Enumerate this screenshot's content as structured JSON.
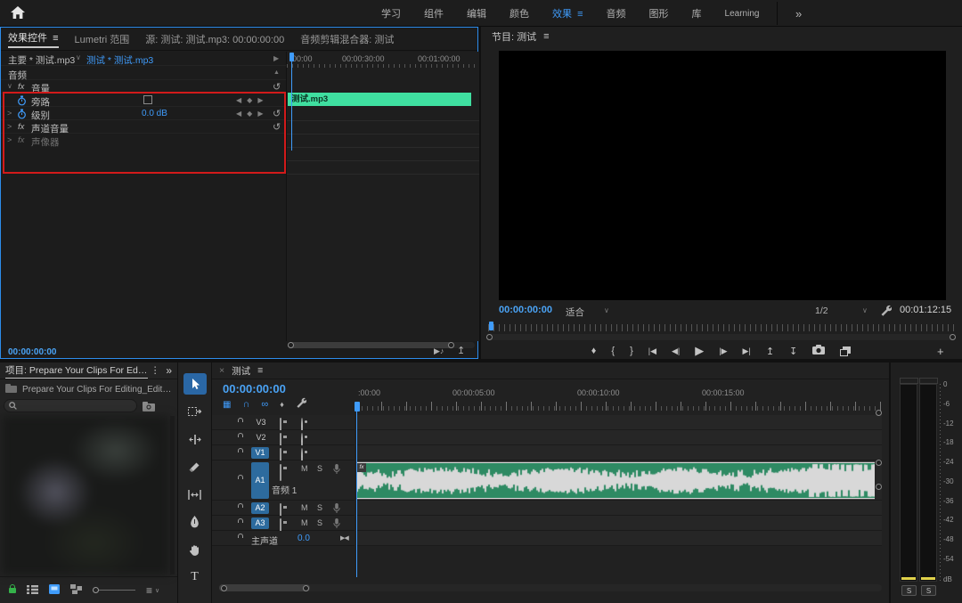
{
  "app": {
    "workspaces": [
      "学习",
      "组件",
      "编辑",
      "颜色",
      "效果",
      "音频",
      "图形",
      "库",
      "Learning"
    ],
    "active_workspace": "效果",
    "overflow": "»"
  },
  "icons": {
    "menu": "≡",
    "kebab": "⋮",
    "overflow": "»",
    "close": "×",
    "chev_down": "∨",
    "chev_right": "▶",
    "chev_up": "▲",
    "twirl_closed": ">",
    "reset": "↺",
    "kf_prev": "◀",
    "kf_diamond": "◆",
    "kf_next": "▶",
    "fx": "fx",
    "magnet": "∩",
    "nest": "▦",
    "link": "∞",
    "marker": "♦",
    "bowtie": "▶◀",
    "play_audio": "▶♪",
    "export_frame": "↥",
    "sort": "≡",
    "plus": "+"
  },
  "effect_controls": {
    "tabs": [
      {
        "label": "效果控件",
        "active": true
      },
      {
        "label": "Lumetri 范围",
        "active": false
      },
      {
        "label": "源: 测试: 测试.mp3: 00:00:00:00",
        "active": false
      },
      {
        "label": "音频剪辑混合器: 测试",
        "active": false
      }
    ],
    "clip_selector": {
      "master": "主要 * 测试.mp3",
      "linked": "测试 * 测试.mp3"
    },
    "rows": {
      "section": "音频",
      "volume": "音量",
      "bypass": "旁路",
      "level": "级别",
      "level_value": "0.0 dB",
      "channel_volume": "声道音量",
      "panner": "声像器"
    },
    "mini_ruler": [
      "00:00",
      "00:00:30:00",
      "00:01:00:00"
    ],
    "mini_clip": "测试.mp3",
    "timecode": "00:00:00:00"
  },
  "program": {
    "tab": "节目: 测试",
    "timecode": "00:00:00:00",
    "fit": "适合",
    "playback_resolution": "1/2",
    "duration": "00:01:12:15",
    "transport": {
      "marker": "♦",
      "mark_in": "{",
      "mark_out": "}",
      "goto_in": "|◀",
      "step_back": "◀|",
      "play": "▶",
      "step_fwd": "|▶",
      "goto_out": "▶|",
      "lift": "↥",
      "extract": "↧",
      "plus": "+"
    }
  },
  "project": {
    "tab": "项目: Prepare Your Clips For Editing_Edited",
    "breadcrumb": "Prepare Your Clips For Editing_Edited.prproj",
    "search_value": ""
  },
  "tools": {
    "selection": "选择工具",
    "track_select": "向前选择轨道工具",
    "ripple": "波纹编辑工具",
    "razor": "剃刀工具",
    "slip": "外滑工具",
    "pen": "钢笔工具",
    "hand": "手形工具",
    "type_label": "T"
  },
  "timeline": {
    "tab": "测试",
    "timecode": "00:00:00:00",
    "ruler": [
      ":00:00",
      "00:00:05:00",
      "00:00:10:00",
      "00:00:15:00"
    ],
    "tracks": {
      "v": [
        "V3",
        "V2",
        "V1"
      ],
      "a": [
        "A1",
        "A2",
        "A3"
      ]
    },
    "a1_label": "音频 1",
    "mute": "M",
    "solo": "S",
    "master": {
      "label": "主声道",
      "value": "0.0"
    },
    "clip": {
      "fx_badge": "fx",
      "bg": "#d8d8d8",
      "wave_color": "#2e8a63"
    }
  },
  "meters": {
    "scale": [
      "0",
      "-6",
      "-12",
      "-18",
      "-24",
      "-30",
      "-36",
      "-42",
      "-48",
      "-54"
    ],
    "unit": "dB",
    "solo": "S",
    "level_color": "#e0d24a"
  },
  "annotation": {
    "color": "#d21a1a"
  }
}
